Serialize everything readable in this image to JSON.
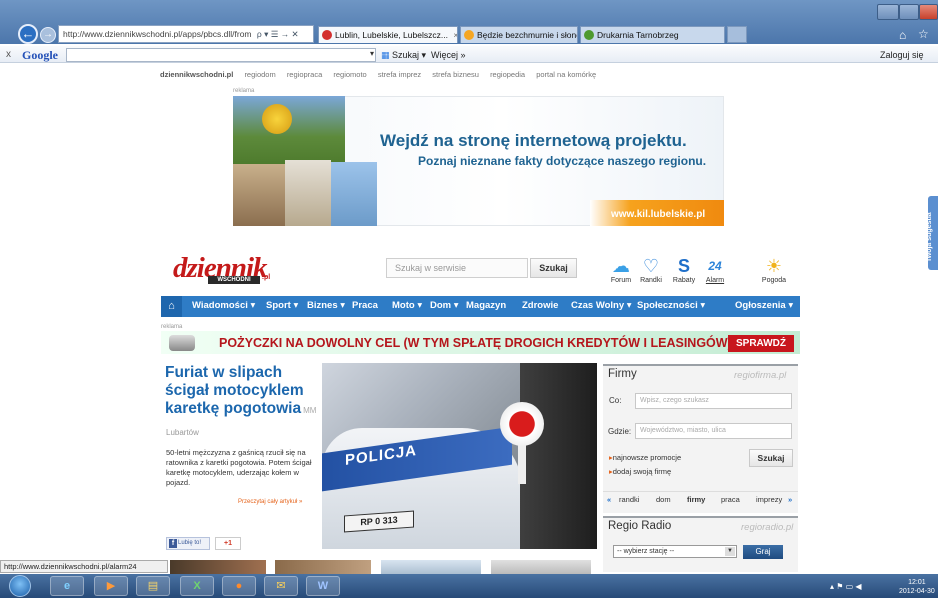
{
  "browser": {
    "address_url": "http://www.dziennikwschodni.pl/apps/pbcs.dll/from",
    "address_icons": "ρ ▾ ☰ → ✕",
    "tabs": [
      {
        "label": "Lublin, Lubelskie, Lubelszcz...",
        "close": "×"
      },
      {
        "label": "Będzie bezchmurnie i słoneczn..."
      },
      {
        "label": "Drukarnia Tarnobrzeg"
      }
    ],
    "back_glyph": "←",
    "forward_glyph": "→"
  },
  "google_toolbar": {
    "close": "x",
    "logo": "Google",
    "search_button": "Szukaj",
    "more_button": "Więcej »",
    "login": "Zaloguj się"
  },
  "top_links": [
    "dziennikwschodni.pl",
    "regiodom",
    "regiopraca",
    "regiomoto",
    "strefa imprez",
    "strefa biznesu",
    "regiopedia",
    "portal na komórkę"
  ],
  "banner": {
    "reklama": "reklama",
    "headline": "Wejdź na stronę internetową projektu.",
    "subheadline": "Poznaj nieznane fakty dotyczące naszego regionu.",
    "url": "www.kil.lubelskie.pl"
  },
  "side_tab": "Twoja sugestia",
  "site": {
    "logo": "dziennik",
    "logo_sub": "WSCHODNI",
    "logo_pl": ".pl",
    "search_placeholder": "Szukaj w serwisie",
    "search_button": "Szukaj"
  },
  "services": [
    {
      "label": "Forum",
      "glyph": "☁",
      "color": "#3aa0e6"
    },
    {
      "label": "Randki",
      "glyph": "♡",
      "color": "#2d84d9"
    },
    {
      "label": "Rabaty",
      "glyph": "S",
      "color": "#1f6fc9"
    },
    {
      "label": "Alarm",
      "glyph": "24",
      "color": "#2d84d9"
    },
    {
      "label": "Pogoda",
      "glyph": "☀",
      "color": "#f0b21c"
    }
  ],
  "nav": {
    "home": "⌂",
    "items": [
      "Wiadomości ▾",
      "Sport ▾",
      "Biznes ▾",
      "Praca",
      "Moto ▾",
      "Dom ▾",
      "Magazyn",
      "Zdrowie",
      "Czas Wolny ▾",
      "Społeczności ▾",
      "Ogłoszenia ▾"
    ]
  },
  "ad_strip": {
    "reklama": "reklama",
    "text": "POŻYCZKI NA DOWOLNY CEL (W TYM SPŁATĘ DROGICH KREDYTÓW I LEASINGÓW)",
    "button": "SPRAWDŹ"
  },
  "article": {
    "title": "Furiat w slipach ścigał motocyklem karetkę pogotowia",
    "badge": "MM",
    "location": "Lubartów",
    "lead": "50-letni mężczyzna z gaśnicą rzucił się na ratownika z karetki pogotowia. Potem ścigał karetkę motocyklem, uderzając kołem w pojazd.",
    "read_more": "Przeczytaj cały artykuł »",
    "like": "Lubię to!",
    "plus": "+1",
    "photo_text": "POLICJA",
    "plate": "RP 0 313"
  },
  "firmy": {
    "title": "Firmy",
    "logo": "regiofirma.pl",
    "co_label": "Co:",
    "co_placeholder": "Wpisz, czego szukasz",
    "gdzie_label": "Gdzie:",
    "gdzie_placeholder": "Województwo, miasto, ulica",
    "link1": "najnowsze promocje",
    "link2": "dodaj swoją firmę",
    "search_button": "Szukaj",
    "tabs": [
      "«",
      "randki",
      "dom",
      "firmy",
      "praca",
      "imprezy",
      "»"
    ]
  },
  "radio": {
    "title": "Regio Radio",
    "logo": "regioradio.pl",
    "select": "-- wybierz stację --",
    "play": "Graj"
  },
  "status_url": "http://www.dziennikwschodni.pl/alarm24",
  "taskbar": {
    "apps": [
      "e",
      "▶",
      "▤",
      "X",
      "●",
      "✉",
      "W"
    ],
    "tray": "▴  ⚑  ▭  ◀",
    "time": "12:01",
    "date": "2012-04-30"
  }
}
